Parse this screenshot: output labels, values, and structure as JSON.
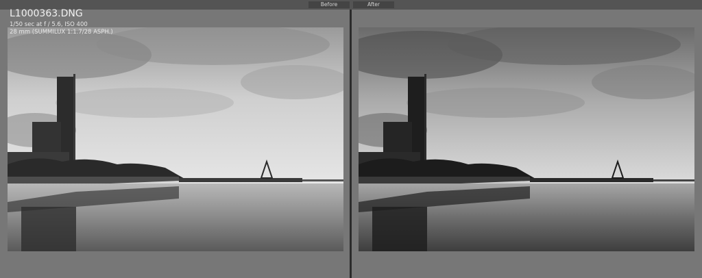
{
  "tabs": {
    "before": "Before",
    "after": "After"
  },
  "info": {
    "filename": "L1000363.DNG",
    "exposure": "1/50 sec at f / 5.6, ISO 400",
    "lens": "28 mm (SUMMILUX 1:1.7/28 ASPH.)"
  },
  "colors": {
    "background": "#6e6e6e",
    "tab": "#444444",
    "divider": "#2b2b2b"
  }
}
